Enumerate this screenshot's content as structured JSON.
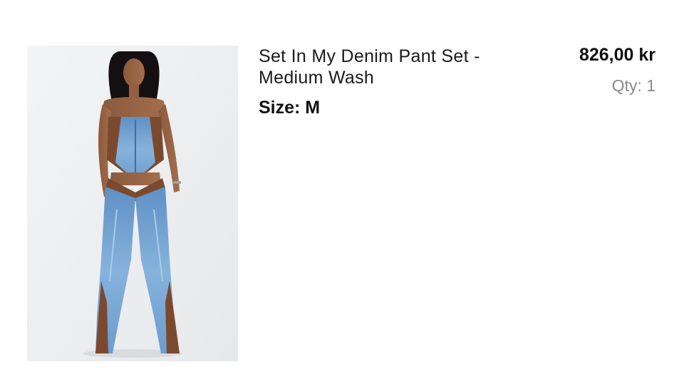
{
  "cart_item": {
    "title": "Set In My Denim Pant Set - Medium Wash",
    "size_text": "Size: M",
    "price": "826,00 kr",
    "quantity_text": "Qty: 1",
    "image_subject": "model wearing denim corset top and flared denim pants with brown panels"
  },
  "colors": {
    "background": "#ffffff",
    "photo_background": "#eeeff1",
    "title_text": "#1a1a1a",
    "qty_text": "#8a8a8a",
    "denim": "#6f9fcf",
    "brown_panel": "#7b4a2e"
  }
}
